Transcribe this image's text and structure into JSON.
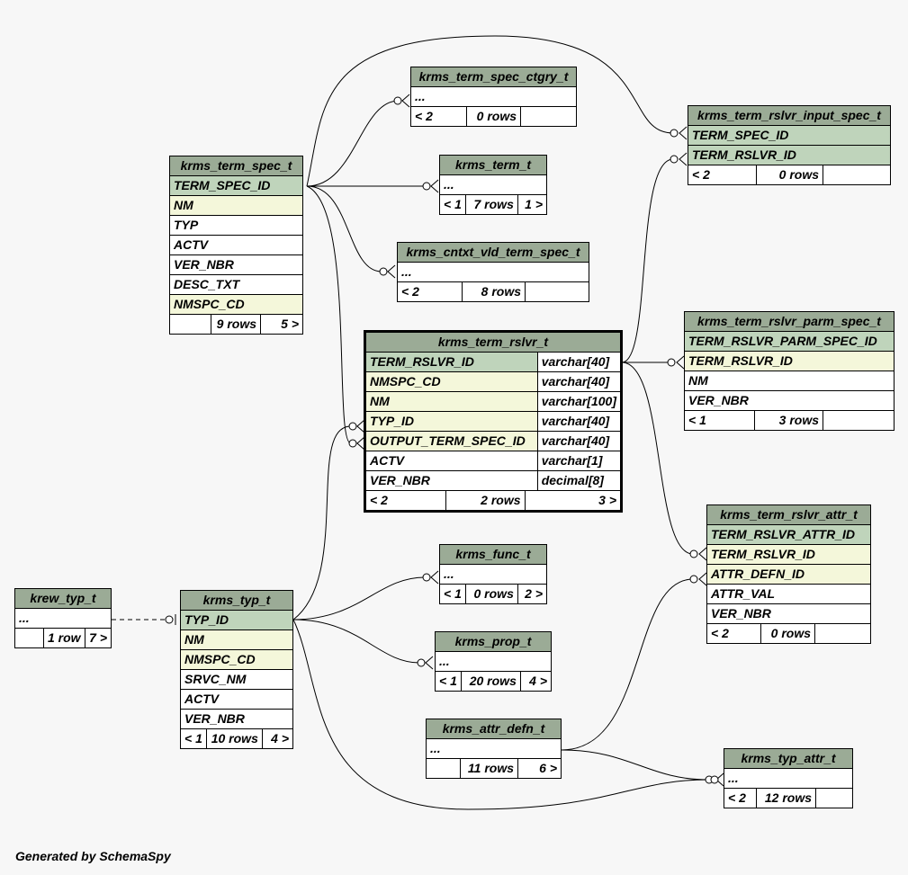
{
  "footer": "Generated by SchemaSpy",
  "tables": {
    "krms_term_spec_ctgry_t": {
      "name": "krms_term_spec_ctgry_t",
      "ellipsis": "...",
      "prev": "< 2",
      "rows": "0 rows",
      "next": ""
    },
    "krms_term_t": {
      "name": "krms_term_t",
      "ellipsis": "...",
      "prev": "< 1",
      "rows": "7 rows",
      "next": "1 >"
    },
    "krms_cntxt_vld_term_spec_t": {
      "name": "krms_cntxt_vld_term_spec_t",
      "ellipsis": "...",
      "prev": "< 2",
      "rows": "8 rows",
      "next": ""
    },
    "krms_term_rslvr_input_spec_t": {
      "name": "krms_term_rslvr_input_spec_t",
      "columns": [
        "TERM_SPEC_ID",
        "TERM_RSLVR_ID"
      ],
      "prev": "< 2",
      "rows": "0 rows",
      "next": ""
    },
    "krms_term_spec_t": {
      "name": "krms_term_spec_t",
      "columns": [
        "TERM_SPEC_ID",
        "NM",
        "TYP",
        "ACTV",
        "VER_NBR",
        "DESC_TXT",
        "NMSPC_CD"
      ],
      "prev": "",
      "rows": "9 rows",
      "next": "5 >"
    },
    "krms_term_rslvr_t": {
      "name": "krms_term_rslvr_t",
      "columns": [
        {
          "name": "TERM_RSLVR_ID",
          "type": "varchar[40]"
        },
        {
          "name": "NMSPC_CD",
          "type": "varchar[40]"
        },
        {
          "name": "NM",
          "type": "varchar[100]"
        },
        {
          "name": "TYP_ID",
          "type": "varchar[40]"
        },
        {
          "name": "OUTPUT_TERM_SPEC_ID",
          "type": "varchar[40]"
        },
        {
          "name": "ACTV",
          "type": "varchar[1]"
        },
        {
          "name": "VER_NBR",
          "type": "decimal[8]"
        }
      ],
      "prev": "< 2",
      "rows": "2 rows",
      "next": "3 >"
    },
    "krms_term_rslvr_parm_spec_t": {
      "name": "krms_term_rslvr_parm_spec_t",
      "columns": [
        "TERM_RSLVR_PARM_SPEC_ID",
        "TERM_RSLVR_ID",
        "NM",
        "VER_NBR"
      ],
      "prev": "< 1",
      "rows": "3 rows",
      "next": ""
    },
    "krms_term_rslvr_attr_t": {
      "name": "krms_term_rslvr_attr_t",
      "columns": [
        "TERM_RSLVR_ATTR_ID",
        "TERM_RSLVR_ID",
        "ATTR_DEFN_ID",
        "ATTR_VAL",
        "VER_NBR"
      ],
      "prev": "< 2",
      "rows": "0 rows",
      "next": ""
    },
    "krms_func_t": {
      "name": "krms_func_t",
      "ellipsis": "...",
      "prev": "< 1",
      "rows": "0 rows",
      "next": "2 >"
    },
    "krew_typ_t": {
      "name": "krew_typ_t",
      "ellipsis": "...",
      "prev": "",
      "rows": "1 row",
      "next": "7 >"
    },
    "krms_typ_t": {
      "name": "krms_typ_t",
      "columns": [
        "TYP_ID",
        "NM",
        "NMSPC_CD",
        "SRVC_NM",
        "ACTV",
        "VER_NBR"
      ],
      "prev": "< 1",
      "rows": "10 rows",
      "next": "4 >"
    },
    "krms_prop_t": {
      "name": "krms_prop_t",
      "ellipsis": "...",
      "prev": "< 1",
      "rows": "20 rows",
      "next": "4 >"
    },
    "krms_attr_defn_t": {
      "name": "krms_attr_defn_t",
      "ellipsis": "...",
      "prev": "",
      "rows": "11 rows",
      "next": "6 >"
    },
    "krms_typ_attr_t": {
      "name": "krms_typ_attr_t",
      "ellipsis": "...",
      "prev": "< 2",
      "rows": "12 rows",
      "next": ""
    }
  }
}
